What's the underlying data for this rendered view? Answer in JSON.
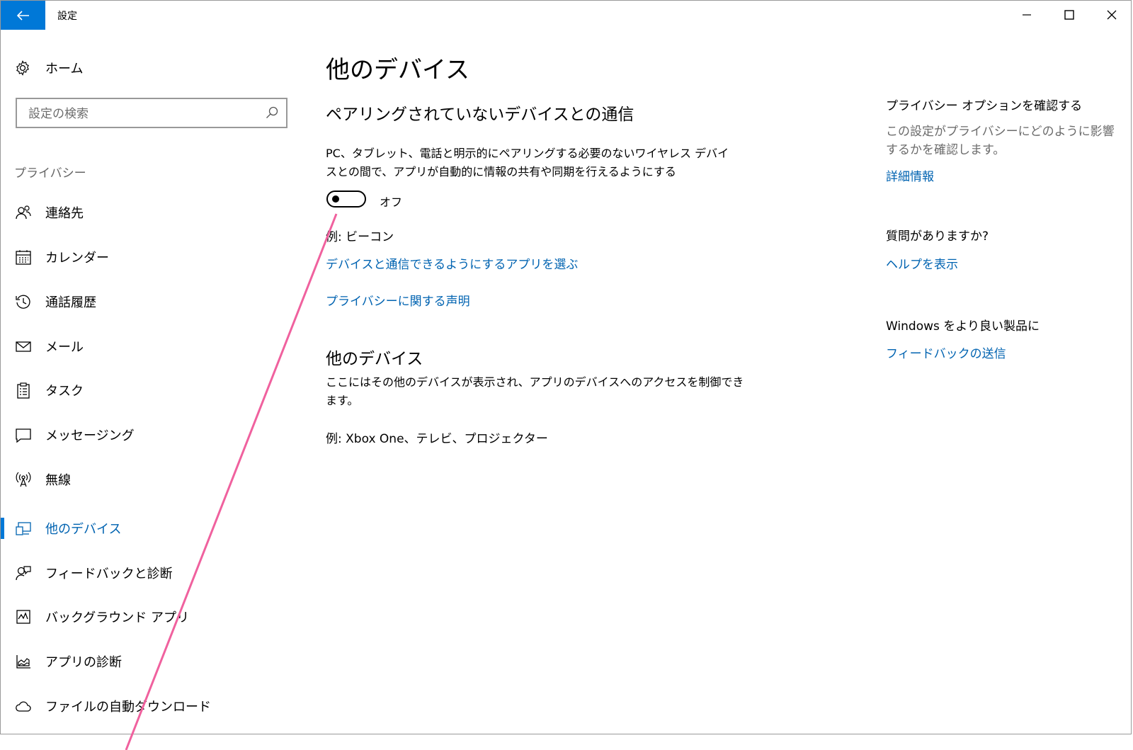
{
  "window": {
    "title": "設定"
  },
  "sidebar": {
    "home_label": "ホーム",
    "search_placeholder": "設定の検索",
    "section_label": "プライバシー",
    "items": [
      {
        "label": "連絡先",
        "icon": "contacts-icon"
      },
      {
        "label": "カレンダー",
        "icon": "calendar-icon"
      },
      {
        "label": "通話履歴",
        "icon": "call-history-icon"
      },
      {
        "label": "メール",
        "icon": "mail-icon"
      },
      {
        "label": "タスク",
        "icon": "tasks-icon"
      },
      {
        "label": "メッセージング",
        "icon": "messaging-icon"
      },
      {
        "label": "無線",
        "icon": "radio-icon"
      },
      {
        "label": "他のデバイス",
        "icon": "other-devices-icon",
        "active": true
      },
      {
        "label": "フィードバックと診断",
        "icon": "feedback-icon"
      },
      {
        "label": "バックグラウンド アプリ",
        "icon": "background-apps-icon"
      },
      {
        "label": "アプリの診断",
        "icon": "app-diagnostics-icon"
      },
      {
        "label": "ファイルの自動ダウンロード",
        "icon": "cloud-icon"
      }
    ]
  },
  "main": {
    "title": "他のデバイス",
    "unpaired_heading": "ペアリングされていないデバイスとの通信",
    "unpaired_desc_line1": "PC、タブレット、電話と明示的にペアリングする必要のないワイヤレス デバイ",
    "unpaired_desc_line2": "スとの間で、アプリが自動的に情報の共有や同期を行えるようにする",
    "toggle_state": "オフ",
    "toggle_on": false,
    "example_beacon": "例: ビーコン",
    "choose_apps_link": "デバイスと通信できるようにするアプリを選ぶ",
    "privacy_statement_link": "プライバシーに関する声明",
    "other_heading": "他のデバイス",
    "other_desc_line1": "ここにはその他のデバイスが表示され、アプリのデバイスへのアクセスを制御でき",
    "other_desc_line2": "ます。",
    "other_example": "例: Xbox One、テレビ、プロジェクター"
  },
  "right": {
    "privacy_title": "プライバシー オプションを確認する",
    "privacy_desc_line1": "この設定がプライバシーにどのように影響",
    "privacy_desc_line2": "するかを確認します。",
    "details_link": "詳細情報",
    "question_title": "質問がありますか?",
    "help_link": "ヘルプを表示",
    "improve_title": "Windows をより良い製品に",
    "feedback_link": "フィードバックの送信"
  },
  "colors": {
    "accent": "#0078d7",
    "link": "#0063b1",
    "annotation_line": "#f0619e"
  }
}
